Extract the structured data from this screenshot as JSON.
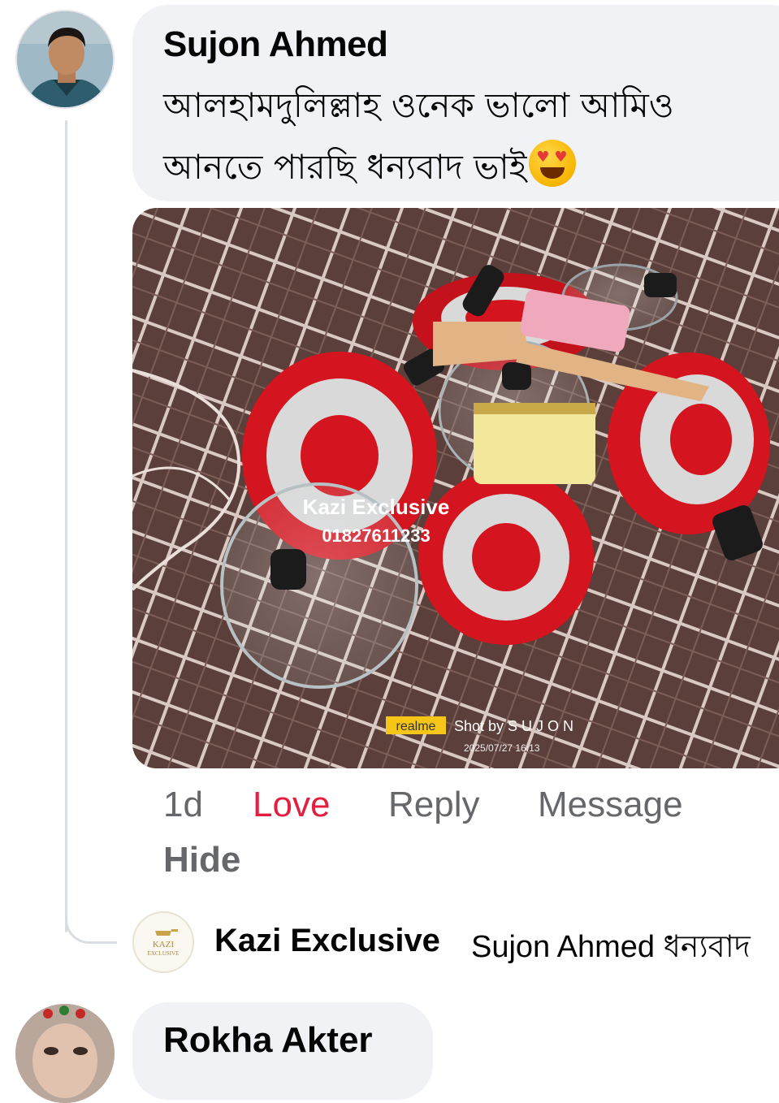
{
  "comment": {
    "author": "Sujon Ahmed",
    "text_line1": "আলহামদুলিল্লাহ ওনেক ভালো আমিও",
    "text_line2": "আনতে পারছি ধন্যবাদ ভাই",
    "emoji": "heart-eyes-emoji",
    "photo": {
      "watermark_name": "Kazi Exclusive",
      "watermark_phone": "01827611233",
      "camera_brand": "realme",
      "shot_by": "Shot by S U J O N",
      "timestamp": "2025/07/27 16:13"
    },
    "actions": {
      "time": "1d",
      "love": "Love",
      "reply": "Reply",
      "message": "Message",
      "hide": "Hide"
    }
  },
  "reply": {
    "author": "Kazi Exclusive",
    "text": "Sujon Ahmed ধন্যবাদ",
    "logo_text1": "KAZI",
    "logo_text2": "EXCLUSIVE"
  },
  "next_comment": {
    "author": "Rokha Akter"
  },
  "colors": {
    "bubble": "#f0f2f5",
    "love": "#e41e3f",
    "secondary_text": "#65676b",
    "pan_red": "#d4141e"
  }
}
